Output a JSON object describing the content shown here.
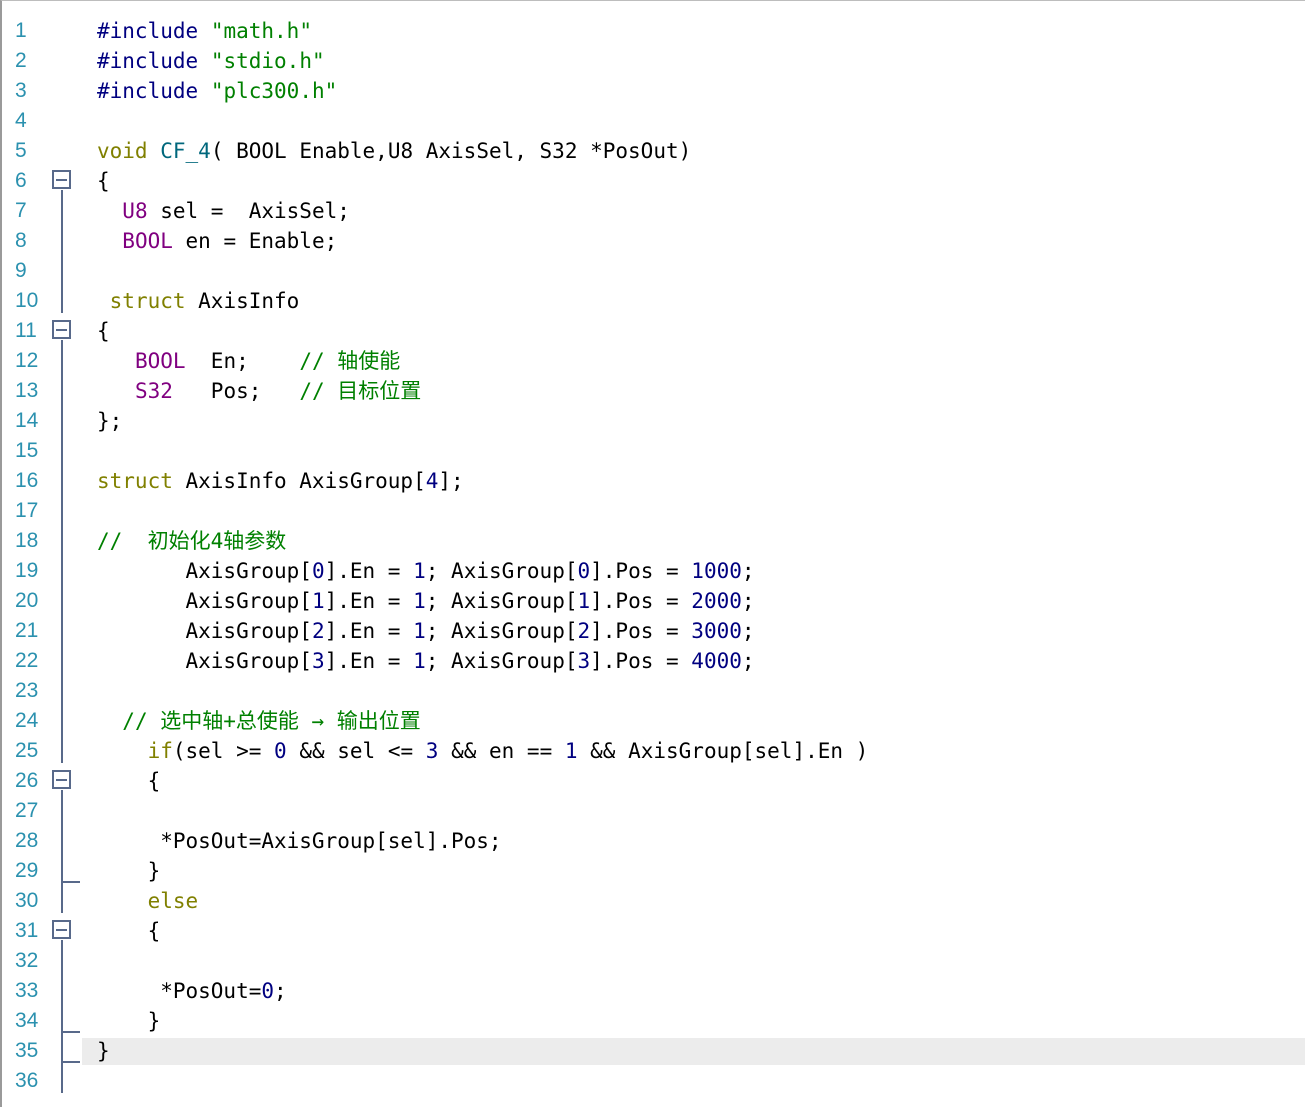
{
  "editor": {
    "lines": [
      {
        "n": "1",
        "tokens": [
          [
            "pp",
            "#include"
          ],
          [
            "op",
            " "
          ],
          [
            "str",
            "\"math.h\""
          ]
        ]
      },
      {
        "n": "2",
        "tokens": [
          [
            "pp",
            "#include"
          ],
          [
            "op",
            " "
          ],
          [
            "str",
            "\"stdio.h\""
          ]
        ]
      },
      {
        "n": "3",
        "tokens": [
          [
            "pp",
            "#include"
          ],
          [
            "op",
            " "
          ],
          [
            "str",
            "\"plc300.h\""
          ]
        ]
      },
      {
        "n": "4",
        "tokens": []
      },
      {
        "n": "5",
        "tokens": [
          [
            "kw",
            "void"
          ],
          [
            "op",
            " "
          ],
          [
            "fn",
            "CF_4"
          ],
          [
            "op",
            "( BOOL Enable,U8 AxisSel, S32 *PosOut)"
          ]
        ]
      },
      {
        "n": "6",
        "tokens": [
          [
            "op",
            "{"
          ]
        ],
        "fold": true
      },
      {
        "n": "7",
        "tokens": [
          [
            "op",
            "  "
          ],
          [
            "tp",
            "U8"
          ],
          [
            "op",
            " sel =  AxisSel;"
          ]
        ]
      },
      {
        "n": "8",
        "tokens": [
          [
            "op",
            "  "
          ],
          [
            "tp",
            "BOOL"
          ],
          [
            "op",
            " en = Enable;"
          ]
        ]
      },
      {
        "n": "9",
        "tokens": []
      },
      {
        "n": "10",
        "tokens": [
          [
            "op",
            " "
          ],
          [
            "kw",
            "struct"
          ],
          [
            "op",
            " AxisInfo"
          ]
        ]
      },
      {
        "n": "11",
        "tokens": [
          [
            "op",
            "{"
          ]
        ],
        "fold": true
      },
      {
        "n": "12",
        "tokens": [
          [
            "op",
            "   "
          ],
          [
            "tp",
            "BOOL"
          ],
          [
            "op",
            "  En;    "
          ],
          [
            "cmt",
            "// 轴使能"
          ]
        ]
      },
      {
        "n": "13",
        "tokens": [
          [
            "op",
            "   "
          ],
          [
            "tp",
            "S32"
          ],
          [
            "op",
            "   Pos;   "
          ],
          [
            "cmt",
            "// 目标位置"
          ]
        ]
      },
      {
        "n": "14",
        "tokens": [
          [
            "op",
            "};"
          ]
        ]
      },
      {
        "n": "15",
        "tokens": []
      },
      {
        "n": "16",
        "tokens": [
          [
            "kw",
            "struct"
          ],
          [
            "op",
            " AxisInfo AxisGroup["
          ],
          [
            "num",
            "4"
          ],
          [
            "op",
            "];"
          ]
        ]
      },
      {
        "n": "17",
        "tokens": []
      },
      {
        "n": "18",
        "tokens": [
          [
            "cmt",
            "//  初始化4轴参数"
          ]
        ]
      },
      {
        "n": "19",
        "tokens": [
          [
            "op",
            "       AxisGroup["
          ],
          [
            "num",
            "0"
          ],
          [
            "op",
            "].En = "
          ],
          [
            "num",
            "1"
          ],
          [
            "op",
            "; AxisGroup["
          ],
          [
            "num",
            "0"
          ],
          [
            "op",
            "].Pos = "
          ],
          [
            "num",
            "1000"
          ],
          [
            "op",
            ";"
          ]
        ]
      },
      {
        "n": "20",
        "tokens": [
          [
            "op",
            "       AxisGroup["
          ],
          [
            "num",
            "1"
          ],
          [
            "op",
            "].En = "
          ],
          [
            "num",
            "1"
          ],
          [
            "op",
            "; AxisGroup["
          ],
          [
            "num",
            "1"
          ],
          [
            "op",
            "].Pos = "
          ],
          [
            "num",
            "2000"
          ],
          [
            "op",
            ";"
          ]
        ]
      },
      {
        "n": "21",
        "tokens": [
          [
            "op",
            "       AxisGroup["
          ],
          [
            "num",
            "2"
          ],
          [
            "op",
            "].En = "
          ],
          [
            "num",
            "1"
          ],
          [
            "op",
            "; AxisGroup["
          ],
          [
            "num",
            "2"
          ],
          [
            "op",
            "].Pos = "
          ],
          [
            "num",
            "3000"
          ],
          [
            "op",
            ";"
          ]
        ]
      },
      {
        "n": "22",
        "tokens": [
          [
            "op",
            "       AxisGroup["
          ],
          [
            "num",
            "3"
          ],
          [
            "op",
            "].En = "
          ],
          [
            "num",
            "1"
          ],
          [
            "op",
            "; AxisGroup["
          ],
          [
            "num",
            "3"
          ],
          [
            "op",
            "].Pos = "
          ],
          [
            "num",
            "4000"
          ],
          [
            "op",
            ";"
          ]
        ]
      },
      {
        "n": "23",
        "tokens": []
      },
      {
        "n": "24",
        "tokens": [
          [
            "op",
            "  "
          ],
          [
            "cmt",
            "// 选中轴+总使能 → 输出位置"
          ]
        ]
      },
      {
        "n": "25",
        "tokens": [
          [
            "op",
            "    "
          ],
          [
            "kw",
            "if"
          ],
          [
            "op",
            "(sel >= "
          ],
          [
            "num",
            "0"
          ],
          [
            "op",
            " && sel <= "
          ],
          [
            "num",
            "3"
          ],
          [
            "op",
            " && en == "
          ],
          [
            "num",
            "1"
          ],
          [
            "op",
            " && AxisGroup[sel].En )"
          ]
        ]
      },
      {
        "n": "26",
        "tokens": [
          [
            "op",
            "    {"
          ]
        ],
        "fold": true
      },
      {
        "n": "27",
        "tokens": []
      },
      {
        "n": "28",
        "tokens": [
          [
            "op",
            "     *PosOut=AxisGroup[sel].Pos;"
          ]
        ]
      },
      {
        "n": "29",
        "tokens": [
          [
            "op",
            "    }"
          ]
        ]
      },
      {
        "n": "30",
        "tokens": [
          [
            "op",
            "    "
          ],
          [
            "kw",
            "else"
          ]
        ]
      },
      {
        "n": "31",
        "tokens": [
          [
            "op",
            "    {"
          ]
        ],
        "fold": true
      },
      {
        "n": "32",
        "tokens": []
      },
      {
        "n": "33",
        "tokens": [
          [
            "op",
            "     *PosOut="
          ],
          [
            "num",
            "0"
          ],
          [
            "op",
            ";"
          ]
        ]
      },
      {
        "n": "34",
        "tokens": [
          [
            "op",
            "    }"
          ]
        ]
      },
      {
        "n": "35",
        "tokens": [
          [
            "op",
            "}"
          ]
        ],
        "current": true
      },
      {
        "n": "36",
        "tokens": []
      }
    ]
  }
}
